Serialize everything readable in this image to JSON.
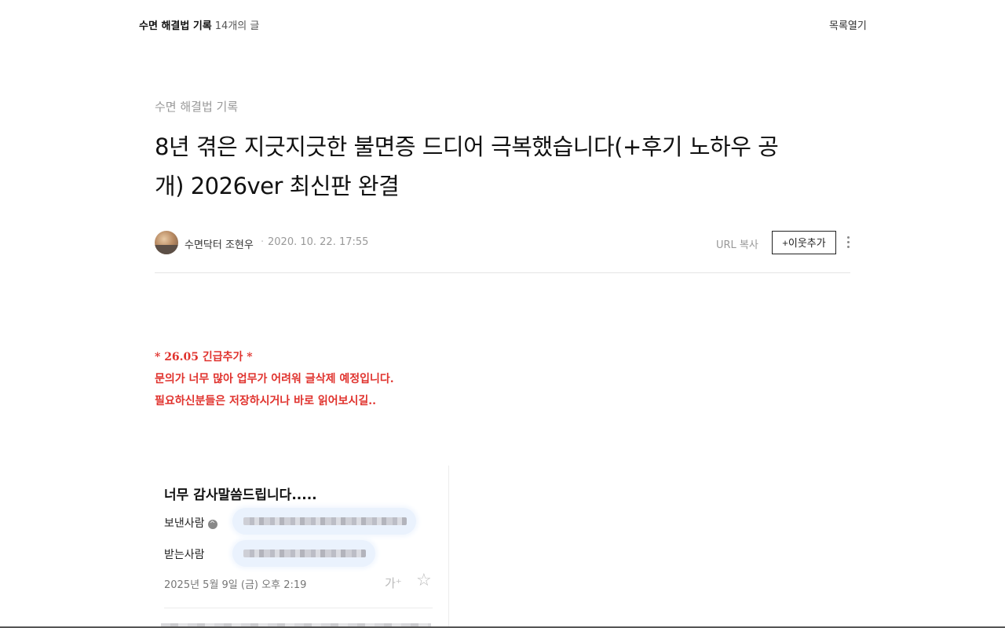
{
  "header": {
    "blog_name": "수면 해결법 기록",
    "post_count": "14개의 글",
    "list_open": "목록열기"
  },
  "post": {
    "category": "수면 해결법 기록",
    "title_line1": "8년 겪은 지긋지긋한 불면증 드디어 극복했습니다(+후기 노하우 공",
    "title_line2": "개) 2026ver 최신판 완결",
    "author": "수면닥터 조현우",
    "separator": "·",
    "date": "2020. 10. 22. 17:55",
    "url_copy": "URL 복사",
    "add_neighbor": "+이웃추가"
  },
  "notice": {
    "line1": "* 26.05 긴급추가 *",
    "line2": "문의가 너무 많아 업무가 어려워 글삭제 예정입니다.",
    "line3": "필요하신분들은 저장하시거나 바로 읽어보시길..",
    "color": "#e0322d"
  },
  "email_card": {
    "subject": "너무 감사말씀드립니다.....",
    "sender_label": "보낸사람",
    "recipient_label": "받는사람",
    "date": "2025년 5월 9일 (금) 오후 2:19",
    "font_icon_label": "가⁺",
    "star_icon": "☆",
    "info_icon": "^"
  },
  "icons": [
    "more-vertical-icon",
    "star-icon",
    "font-size-icon",
    "info-icon",
    "avatar"
  ]
}
